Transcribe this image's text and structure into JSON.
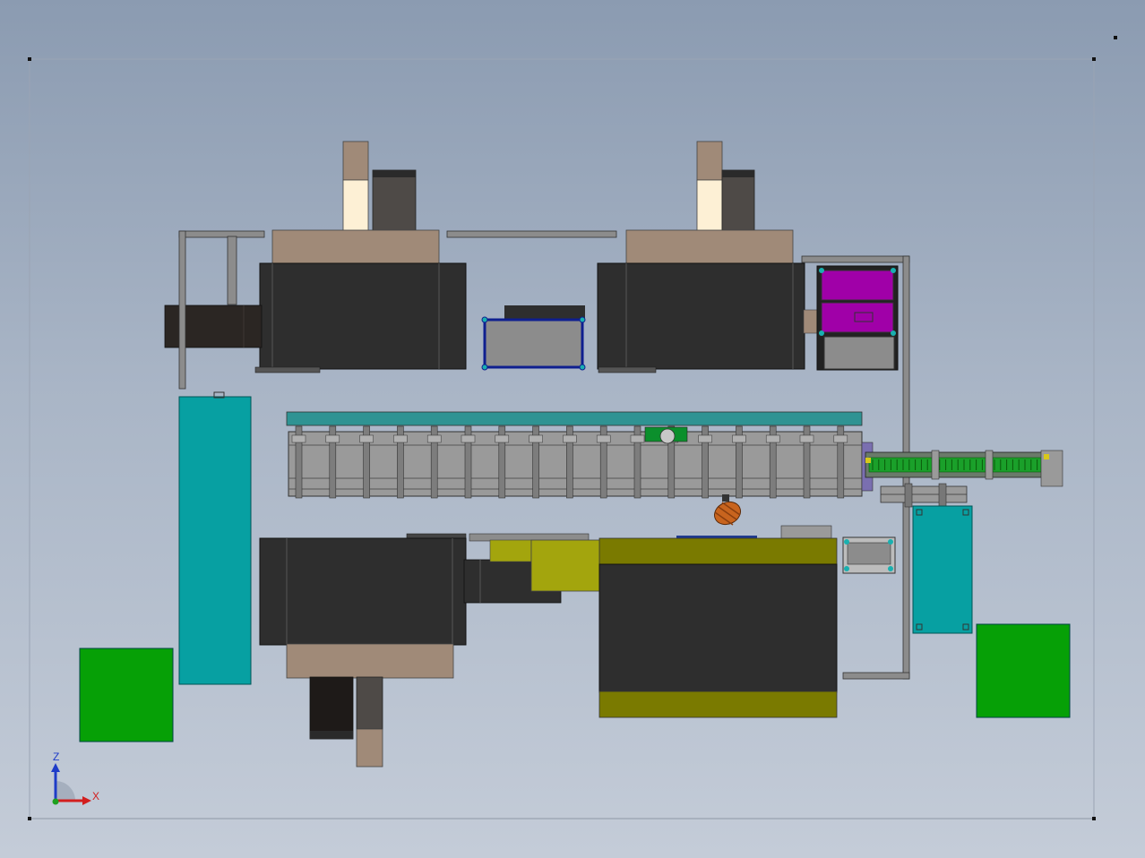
{
  "view": {
    "background_top": "#8b9bb1",
    "background_bottom": "#c4ccd8"
  },
  "triad": {
    "z_label": "Z",
    "x_label": "X",
    "z_color": "#1e3cc8",
    "x_color": "#d21e1e",
    "y_color": "#1ea01e"
  },
  "colors": {
    "machine_dark": "#2e2e2e",
    "machine_tan": "#a08a78",
    "cream": "#fdf0d5",
    "teal": "#07a0a2",
    "green": "#06a006",
    "magenta": "#a000a8",
    "olive": "#7a7a00",
    "yellow_green": "#a3a50d",
    "frame_grey": "#8c8c8c",
    "conveyor_grey": "#9a9a9a",
    "conveyor_teal": "#2f9393",
    "blue_frame": "#0f1f8f",
    "motor_orange": "#c8641e"
  }
}
